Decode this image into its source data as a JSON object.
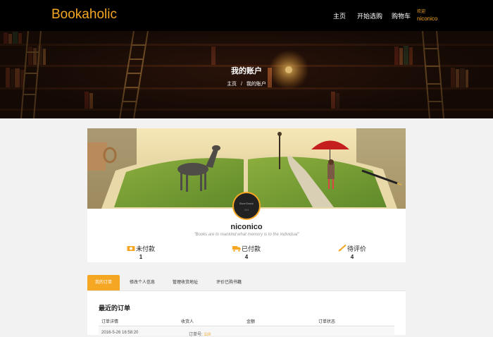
{
  "nav": {
    "brand": "Bookaholic",
    "items": [
      "主页",
      "开始选购",
      "购物车"
    ],
    "welcome_label": "欢迎",
    "welcome_user": "niconico"
  },
  "hero": {
    "title": "我的账户",
    "breadcrumb": [
      "主页",
      "/",
      "我的账户"
    ]
  },
  "profile": {
    "avatar_line1": "BoonTaack",
    "avatar_line2": "404",
    "username": "niconico",
    "quote": "\"Books are to mankind what memory is to the individual\"",
    "stats": [
      {
        "label": "未付款",
        "count": "1",
        "icon": "money-icon"
      },
      {
        "label": "已付款",
        "count": "4",
        "icon": "truck-icon"
      },
      {
        "label": "待评价",
        "count": "4",
        "icon": "brush-icon"
      }
    ]
  },
  "tabs": [
    "我的订单",
    "修改个人信息",
    "管理收货地址",
    "评价已购书籍"
  ],
  "orders": {
    "title": "最近的订单",
    "headers": [
      "订单详情",
      "收货人",
      "金额",
      "订单状态"
    ],
    "first_row_date": "2016-5-26 16:58:20",
    "first_row_order_label": "订单号:",
    "first_row_order_no": "118"
  },
  "colors": {
    "accent": "#f5a623",
    "nav_bg": "#000000"
  }
}
